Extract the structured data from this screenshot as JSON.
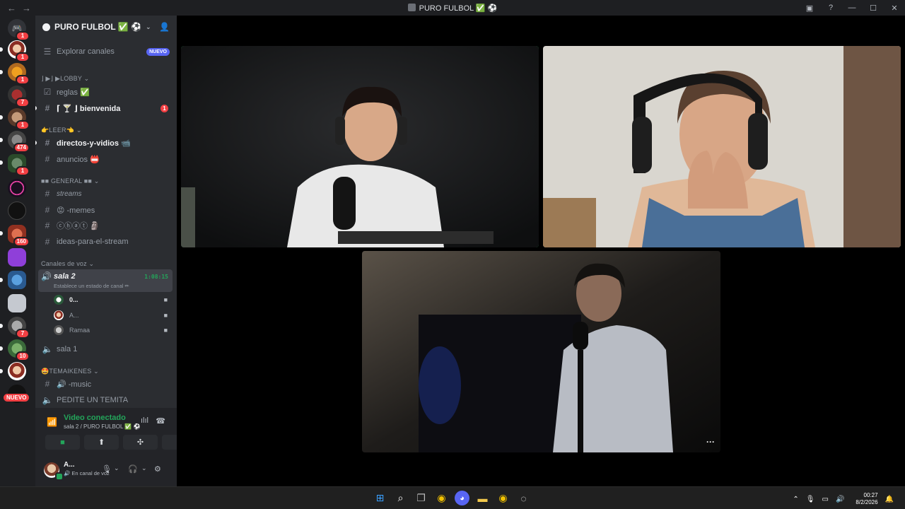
{
  "window": {
    "title": "PURO FULBOL ✅ ⚽",
    "nav_back": "←",
    "nav_forward": "→",
    "controls": {
      "inbox": "▣",
      "help": "?",
      "minimize": "—",
      "maximize": "☐",
      "close": "✕"
    }
  },
  "rail": {
    "badges": [
      "1",
      "1",
      "1",
      "7",
      "1",
      "474",
      "1",
      "160",
      "7",
      "10"
    ],
    "nuevo": "NUEVO"
  },
  "server": {
    "name": "PURO FULBOL ✅ ⚽",
    "explore": {
      "label": "Explorar canales",
      "tag": "NUEVO"
    },
    "categories": {
      "lobby": "⌋ ▶⌋ ▶LOBBY ⌄",
      "leer": "👉LEER👈 ⌄",
      "general": "■■ GENERAL ■■ ⌄",
      "voz": "Canales de voz ⌄",
      "temaikenes": "🤩TEMAIKENES ⌄"
    },
    "channels": {
      "reglas": "reglas ✅",
      "bienvenida": "⌈ 🍸 ⌋ bienvenida",
      "bienvenida_badge": "1",
      "directos": "directos-y-vidios 📹",
      "anuncios": "anuncios 📛",
      "streams": "streams",
      "memes": "😡 -memes",
      "chat": "ⓒⓗⓐⓣ 🗿",
      "ideas": "ideas-para-el-stream",
      "music": "🔊 -music",
      "pedite": "PEDITE UN TEMITA"
    },
    "voice": {
      "active_name": "sala 2",
      "active_status": "Establece un estado de canal ✏",
      "timer": "1:08:15",
      "users": [
        "0...",
        "A...",
        "Ramaa"
      ],
      "sala1": "sala 1"
    }
  },
  "voice_panel": {
    "status": "Video conectado",
    "location": "sala 2 / PURO FULBOL ✅ ⚽"
  },
  "user_panel": {
    "name": "A...",
    "status": "🔊 En canal de voz"
  },
  "taskbar": {
    "time": "00:27",
    "date": "8/2/2026"
  },
  "colors": {
    "accent_green": "#23a55a",
    "notification_red": "#f23f43",
    "blurple": "#5865f2"
  }
}
